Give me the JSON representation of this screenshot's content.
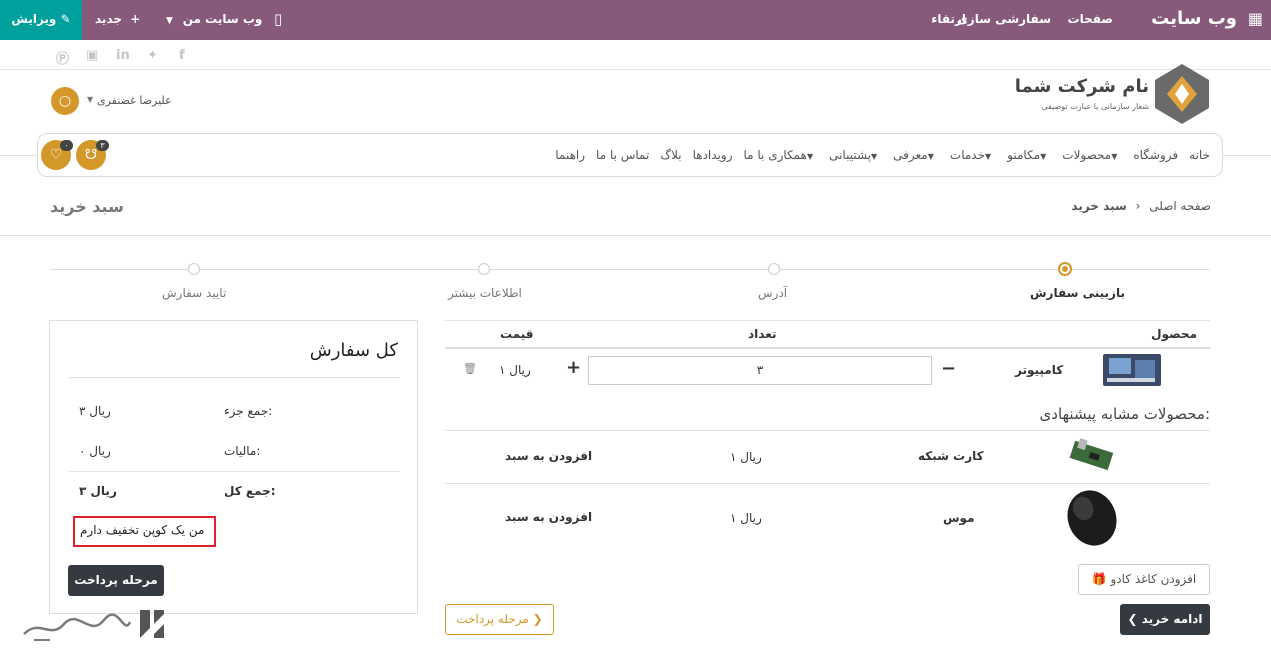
{
  "topbar": {
    "site": "وب سایت",
    "pages": "صفحات",
    "customize": "سفارشی سازی",
    "upgrade": "ارتقاء",
    "my_site": "وب سایت من",
    "new": "جدید",
    "edit": "ویرایش"
  },
  "logo": {
    "name": "نام شرکت شما",
    "tagline": "شعار سازمانی یا عبارت توصیفی"
  },
  "user": {
    "name": "علیرضا غضنفری"
  },
  "menu": [
    {
      "label": "خانه",
      "dropdown": false
    },
    {
      "label": "فروشگاه",
      "dropdown": false
    },
    {
      "label": "محصولات",
      "dropdown": true
    },
    {
      "label": "مکامنو",
      "dropdown": true
    },
    {
      "label": "خدمات",
      "dropdown": true
    },
    {
      "label": "معرفی",
      "dropdown": true
    },
    {
      "label": "پشتیبانی",
      "dropdown": true
    },
    {
      "label": "همکاری با ما",
      "dropdown": true
    },
    {
      "label": "رویدادها",
      "dropdown": false
    },
    {
      "label": "بلاگ",
      "dropdown": false
    },
    {
      "label": "تماس با ما",
      "dropdown": false
    },
    {
      "label": "راهنما",
      "dropdown": false
    }
  ],
  "cart_badge": "۳",
  "wishlist_badge": "۰",
  "breadcrumb": {
    "home": "صفحه اصلی",
    "current": "سبد خرید"
  },
  "page_title": "سبد خرید",
  "steps": [
    "بازبینی سفارش",
    "آدرس",
    "اطلاعات بیشتر",
    "تایید سفارش"
  ],
  "table_headers": {
    "product": "محصول",
    "quantity": "تعداد",
    "price": "قیمت"
  },
  "cart_item": {
    "name": "کامپیوتر",
    "quantity": "۳",
    "price": "۱ ریال"
  },
  "suggested_title": "محصولات مشابه پیشنهادی:",
  "suggested": [
    {
      "name": "کارت شبکه",
      "price": "۱ ریال",
      "action": "افزودن به سبد"
    },
    {
      "name": "موس",
      "price": "۱ ریال",
      "action": "افزودن به سبد"
    }
  ],
  "gift_card": "افزودن کاغذ کادو",
  "continue_shopping": "ادامه خرید",
  "checkout": "مرحله پرداخت",
  "summary": {
    "title": "کل سفارش",
    "subtotal_label": "جمع جزء:",
    "subtotal": "۳ ریال",
    "tax_label": "مالیات:",
    "tax": "۰ ریال",
    "total_label": "جمع کل:",
    "total": "۳ ریال",
    "coupon": "من یک کوپن تخفیف دارم",
    "checkout": "مرحله پرداخت"
  },
  "colors": {
    "topbar": "#875a7b",
    "edit": "#00a09d",
    "accent": "#d4982a",
    "dark": "#343a40",
    "highlight": "#e0202d"
  }
}
